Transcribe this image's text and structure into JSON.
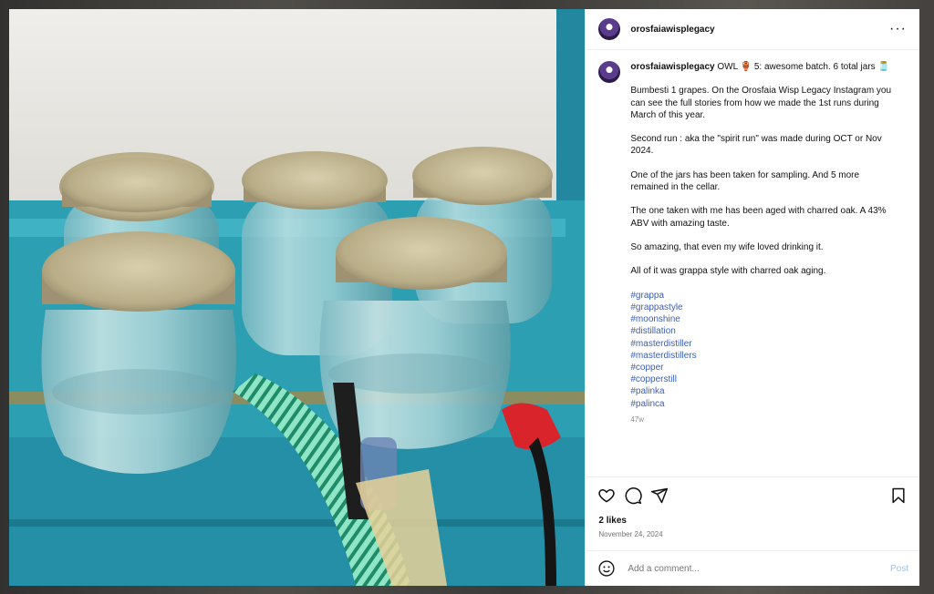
{
  "post": {
    "author": "orosfaiawisplegacy",
    "more_label": "···",
    "caption": {
      "author": "orosfaiawisplegacy",
      "paragraphs": [
        "OWL 🏺 5: awesome batch. 6 total jars 🫙",
        "Bumbesti 1 grapes. On the Orosfaia Wisp Legacy Instagram you can see the full stories from how we made the 1st runs during March of this year.",
        "Second run : aka the \"spirit run\" was made during OCT or Nov 2024.",
        "One of the jars has been taken for sampling. And 5 more remained in the cellar.",
        "The one taken with me has been aged with charred oak. A 43% ABV with amazing taste.",
        "So amazing, that even my wife loved drinking it.",
        "All of it was grappa style with charred oak aging."
      ],
      "hashtags": [
        "#grappa",
        "#grappastyle",
        "#moonshine",
        "#distillation",
        "#masterdistiller",
        "#masterdistillers",
        "#copper",
        "#copperstill",
        "#palinka",
        "#palinca"
      ],
      "ago": "47w"
    },
    "likes": "2 likes",
    "date": "November 24, 2024",
    "comment": {
      "placeholder": "Add a comment...",
      "post_label": "Post"
    }
  },
  "colors": {
    "accent": "#0095f6",
    "hashtag": "#3a5fb5",
    "shelf": "#2a9cb0"
  },
  "icons": {
    "like": "heart-icon",
    "comment": "comment-icon",
    "share": "share-icon",
    "save": "bookmark-icon",
    "emoji": "emoji-icon",
    "more": "more-options-icon"
  }
}
